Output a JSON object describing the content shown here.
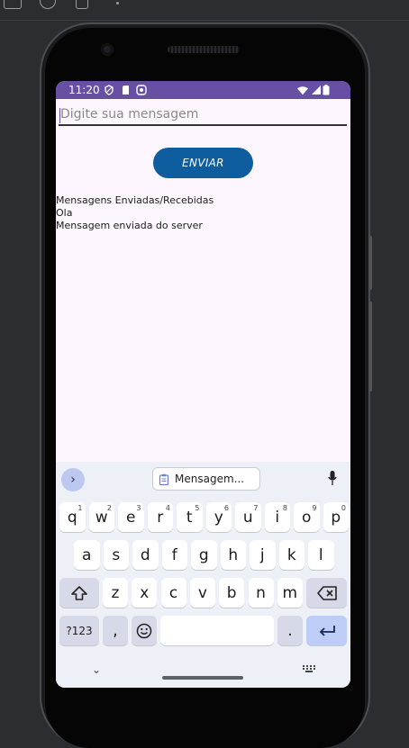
{
  "status_bar": {
    "time": "11:20"
  },
  "input": {
    "placeholder": "Digite sua mensagem",
    "value": ""
  },
  "send_button": {
    "label": "ENVIAR"
  },
  "messages": {
    "header": "Mensagens Enviadas/Recebidas",
    "lines": [
      "Ola",
      "Mensagem enviada do server"
    ]
  },
  "keyboard": {
    "suggestion": "Mensagem...",
    "row1": [
      {
        "key": "q",
        "hint": "1"
      },
      {
        "key": "w",
        "hint": "2"
      },
      {
        "key": "e",
        "hint": "3"
      },
      {
        "key": "r",
        "hint": "4"
      },
      {
        "key": "t",
        "hint": "5"
      },
      {
        "key": "y",
        "hint": "6"
      },
      {
        "key": "u",
        "hint": "7"
      },
      {
        "key": "i",
        "hint": "8"
      },
      {
        "key": "o",
        "hint": "9"
      },
      {
        "key": "p",
        "hint": "0"
      }
    ],
    "row2": [
      "a",
      "s",
      "d",
      "f",
      "g",
      "h",
      "j",
      "k",
      "l"
    ],
    "row3": [
      "z",
      "x",
      "c",
      "v",
      "b",
      "n",
      "m"
    ],
    "symbols_label": "?123",
    "comma": ",",
    "period": "."
  },
  "colors": {
    "status_bar": "#6750a4",
    "screen_bg": "#fdf6fe",
    "send_button": "#0e5d9f",
    "keyboard_bg": "#eef0f7",
    "action_key": "#bdcdf7"
  }
}
